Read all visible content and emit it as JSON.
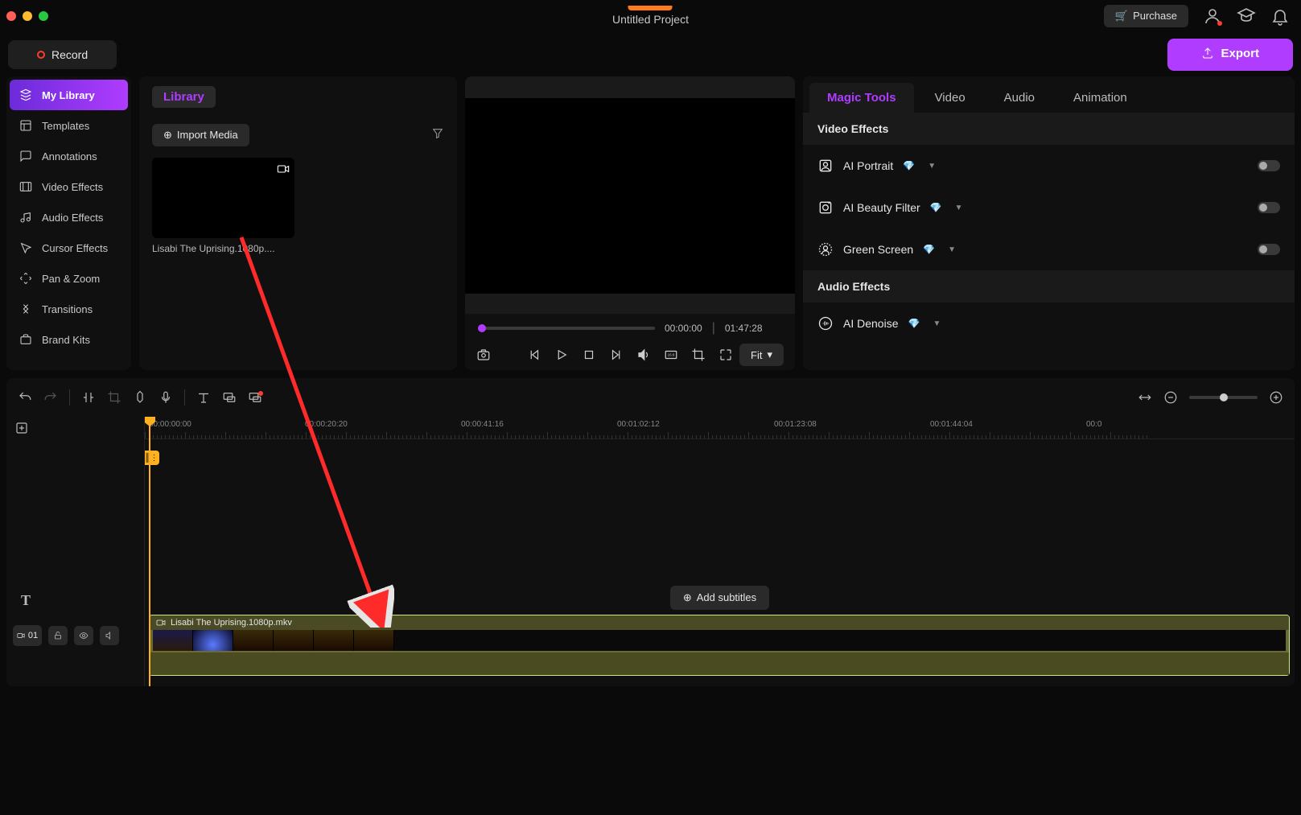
{
  "titlebar": {
    "project_title": "Untitled Project",
    "purchase": "Purchase"
  },
  "toolbar": {
    "record": "Record",
    "export": "Export"
  },
  "sidebar": {
    "items": [
      {
        "label": "My Library"
      },
      {
        "label": "Templates"
      },
      {
        "label": "Annotations"
      },
      {
        "label": "Video Effects"
      },
      {
        "label": "Audio Effects"
      },
      {
        "label": "Cursor Effects"
      },
      {
        "label": "Pan & Zoom"
      },
      {
        "label": "Transitions"
      },
      {
        "label": "Brand Kits"
      }
    ]
  },
  "library": {
    "tab": "Library",
    "import": "Import Media",
    "media": [
      {
        "label": "Lisabi The Uprising.1080p...."
      }
    ]
  },
  "preview": {
    "current_time": "00:00:00",
    "total_time": "01:47:28",
    "fit": "Fit"
  },
  "props": {
    "tabs": {
      "magic": "Magic Tools",
      "video": "Video",
      "audio": "Audio",
      "animation": "Animation"
    },
    "section_video": "Video Effects",
    "section_audio": "Audio Effects",
    "effects": {
      "portrait": "AI Portrait",
      "beauty": "AI Beauty Filter",
      "green": "Green Screen",
      "denoise": "AI Denoise"
    }
  },
  "timeline": {
    "ruler": [
      "00:00:00:00",
      "00:00:20:20",
      "00:00:41:16",
      "00:01:02:12",
      "00:01:23:08",
      "00:01:44:04",
      "00:0"
    ],
    "add_subtitles": "Add subtitles",
    "clip_name": "Lisabi The Uprising.1080p.mkv",
    "track_num": "01"
  }
}
